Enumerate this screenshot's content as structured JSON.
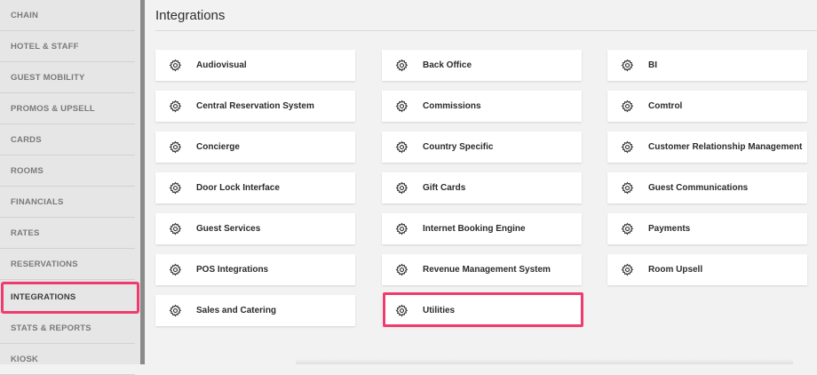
{
  "sidebar": {
    "items": [
      {
        "label": "CHAIN"
      },
      {
        "label": "HOTEL & STAFF"
      },
      {
        "label": "GUEST MOBILITY"
      },
      {
        "label": "PROMOS & UPSELL"
      },
      {
        "label": "CARDS"
      },
      {
        "label": "ROOMS"
      },
      {
        "label": "FINANCIALS"
      },
      {
        "label": "RATES"
      },
      {
        "label": "RESERVATIONS"
      },
      {
        "label": "INTEGRATIONS"
      },
      {
        "label": "STATS & REPORTS"
      },
      {
        "label": "KIOSK"
      }
    ],
    "active": "INTEGRATIONS"
  },
  "main": {
    "title": "Integrations",
    "cards": [
      {
        "label": "Audiovisual",
        "icon": "gear-icon"
      },
      {
        "label": "Back Office",
        "icon": "gear-icon"
      },
      {
        "label": "BI",
        "icon": "gear-icon"
      },
      {
        "label": "Central Reservation System",
        "icon": "gear-icon"
      },
      {
        "label": "Commissions",
        "icon": "gear-icon"
      },
      {
        "label": "Comtrol",
        "icon": "gear-icon"
      },
      {
        "label": "Concierge",
        "icon": "gear-icon"
      },
      {
        "label": "Country Specific",
        "icon": "gear-icon"
      },
      {
        "label": "Customer Relationship Management",
        "icon": "gear-icon"
      },
      {
        "label": "Door Lock Interface",
        "icon": "gear-icon"
      },
      {
        "label": "Gift Cards",
        "icon": "gear-icon"
      },
      {
        "label": "Guest Communications",
        "icon": "gear-icon"
      },
      {
        "label": "Guest Services",
        "icon": "gear-icon"
      },
      {
        "label": "Internet Booking Engine",
        "icon": "gear-icon"
      },
      {
        "label": "Payments",
        "icon": "gear-icon"
      },
      {
        "label": "POS Integrations",
        "icon": "gear-icon"
      },
      {
        "label": "Revenue Management System",
        "icon": "gear-icon"
      },
      {
        "label": "Room Upsell",
        "icon": "gear-icon"
      },
      {
        "label": "Sales and Catering",
        "icon": "gear-icon"
      },
      {
        "label": "Utilities",
        "icon": "gear-icon"
      }
    ],
    "highlighted_card": "Utilities"
  },
  "colors": {
    "highlight": "#ef3b6e",
    "sidebar_bg": "#e6e6e6",
    "page_bg": "#f2f2f2",
    "card_bg": "#ffffff"
  }
}
